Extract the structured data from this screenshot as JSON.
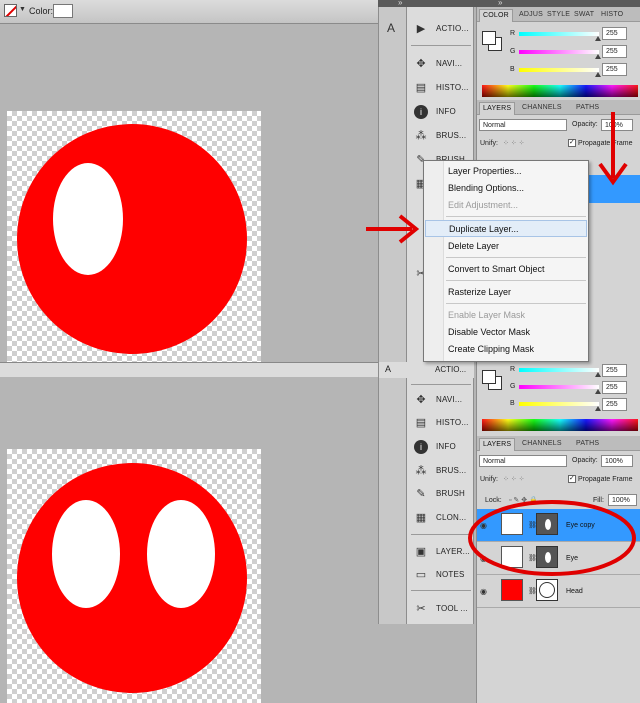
{
  "options_bar": {
    "color_label": "Color:"
  },
  "dock_top": {
    "items": [
      {
        "label": "ACTIO...",
        "icon": "actions-icon"
      },
      {
        "label": "NAVI...",
        "icon": "navigator-icon"
      },
      {
        "label": "HISTO...",
        "icon": "history-icon"
      },
      {
        "label": "INFO",
        "icon": "info-icon"
      },
      {
        "label": "BRUS...",
        "icon": "brushes-icon"
      },
      {
        "label": "BRUSH",
        "icon": "brush-icon"
      }
    ]
  },
  "dock_bottom": {
    "items": [
      {
        "label": "ACTIO...",
        "icon": "actions-icon"
      },
      {
        "label": "NAVI...",
        "icon": "navigator-icon"
      },
      {
        "label": "HISTO...",
        "icon": "history-icon"
      },
      {
        "label": "INFO",
        "icon": "info-icon"
      },
      {
        "label": "BRUS...",
        "icon": "brushes-icon"
      },
      {
        "label": "BRUSH",
        "icon": "brush-icon"
      },
      {
        "label": "CLON...",
        "icon": "clone-source-icon"
      },
      {
        "label": "LAYER...",
        "icon": "layer-comps-icon"
      },
      {
        "label": "NOTES",
        "icon": "notes-icon"
      },
      {
        "label": "TOOL ...",
        "icon": "tool-presets-icon"
      }
    ]
  },
  "color_panel": {
    "tabs": [
      "COLOR",
      "ADJUS",
      "STYLE",
      "SWAT",
      "HISTO"
    ],
    "channels": [
      {
        "label": "R",
        "value": "255",
        "color": "#00cccc"
      },
      {
        "label": "G",
        "value": "255",
        "color": "#cc00cc"
      },
      {
        "label": "B",
        "value": "255",
        "color": "#cccc00"
      }
    ]
  },
  "layers_panel_top": {
    "tabs": [
      "LAYERS",
      "CHANNELS",
      "PATHS"
    ],
    "blend_mode": "Normal",
    "opacity_label": "Opacity:",
    "opacity_value": "100%",
    "unify_label": "Unify:",
    "propagate_label": "Propagate Frame"
  },
  "layers_panel_bottom": {
    "tabs": [
      "LAYERS",
      "CHANNELS",
      "PATHS"
    ],
    "blend_mode": "Normal",
    "opacity_label": "Opacity:",
    "opacity_value": "100%",
    "unify_label": "Unify:",
    "propagate_label": "Propagate Frame",
    "lock_label": "Lock:",
    "fill_label": "Fill:",
    "fill_value": "100%",
    "layers": [
      {
        "name": "Eye copy",
        "selected": true
      },
      {
        "name": "Eye",
        "selected": false
      },
      {
        "name": "Head",
        "selected": false
      }
    ]
  },
  "context_menu": {
    "items": [
      {
        "label": "Layer Properties...",
        "disabled": false
      },
      {
        "label": "Blending Options...",
        "disabled": false
      },
      {
        "label": "Edit Adjustment...",
        "disabled": true
      },
      {
        "label": "Duplicate Layer...",
        "disabled": false,
        "highlighted": true
      },
      {
        "label": "Delete Layer",
        "disabled": false
      },
      {
        "label": "Convert to Smart Object",
        "disabled": false
      },
      {
        "label": "Rasterize Layer",
        "disabled": false
      },
      {
        "label": "Enable Layer Mask",
        "disabled": true
      },
      {
        "label": "Disable Vector Mask",
        "disabled": false
      },
      {
        "label": "Create Clipping Mask",
        "disabled": false
      }
    ]
  },
  "colors": {
    "shape_red": "#ff0000",
    "annotation_red": "#e00000",
    "selection_blue": "#3399ff"
  }
}
